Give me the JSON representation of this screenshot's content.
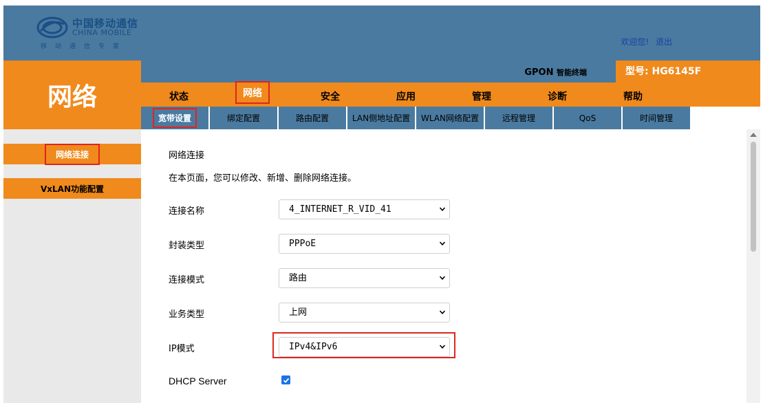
{
  "header": {
    "logo_cn": "中国移动通信",
    "logo_en": "CHINA MOBILE",
    "logo_slogan": "移动通信专家",
    "welcome": "欢迎您!",
    "logout": "退出"
  },
  "product": {
    "device_type": "GPON",
    "device_type_suffix": "智能终端",
    "model": "型号: HG6145F"
  },
  "section_title": "网络",
  "main_nav": [
    {
      "label": "状态"
    },
    {
      "label": "网络"
    },
    {
      "label": "安全"
    },
    {
      "label": "应用"
    },
    {
      "label": "管理"
    },
    {
      "label": "诊断"
    },
    {
      "label": "帮助"
    }
  ],
  "sub_nav": [
    {
      "label": "宽带设置"
    },
    {
      "label": "绑定配置"
    },
    {
      "label": "路由配置"
    },
    {
      "label": "LAN侧地址配置"
    },
    {
      "label": "WLAN网络配置"
    },
    {
      "label": "远程管理"
    },
    {
      "label": "QoS"
    },
    {
      "label": "时间管理"
    }
  ],
  "sidebar": {
    "items": [
      {
        "label": "网络连接"
      },
      {
        "label": "VxLAN功能配置"
      }
    ]
  },
  "content": {
    "title": "网络连接",
    "description": "在本页面，您可以修改、新增、删除网络连接。",
    "fields": [
      {
        "label": "连接名称",
        "value": "4_INTERNET_R_VID_41"
      },
      {
        "label": "封装类型",
        "value": "PPPoE"
      },
      {
        "label": "连接模式",
        "value": "路由"
      },
      {
        "label": "业务类型",
        "value": "上网"
      },
      {
        "label": "IP模式",
        "value": "IPv4&IPv6"
      }
    ],
    "dhcp_label": "DHCP Server",
    "dhcp_checked": true
  },
  "colors": {
    "header_blue": "#4a7aa0",
    "orange": "#f08a1c",
    "highlight_red": "#e0241f",
    "checkbox_blue": "#1a73e8"
  }
}
